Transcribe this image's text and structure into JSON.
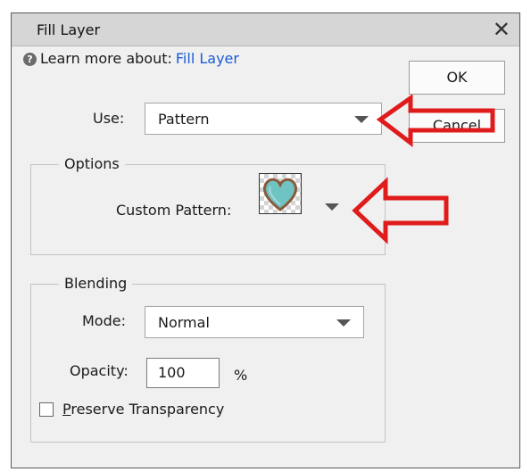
{
  "dialog": {
    "title": "Fill Layer",
    "close_glyph": "✕",
    "help_prefix": "Learn more about:",
    "help_link": "Fill Layer",
    "ok_label": "OK",
    "cancel_label": "Cancel"
  },
  "use": {
    "label": "Use:",
    "value": "Pattern"
  },
  "options": {
    "legend": "Options",
    "pattern_label": "Custom Pattern:",
    "pattern_icon": "heart-pattern-icon"
  },
  "blending": {
    "legend": "Blending",
    "mode_label": "Mode:",
    "mode_value": "Normal",
    "opacity_label": "Opacity:",
    "opacity_value": "100",
    "opacity_unit": "%",
    "preserve_label_underlined": "P",
    "preserve_label_rest": "reserve Transparency",
    "preserve_checked": false
  },
  "annotations": {
    "arrow_color": "#e01b1b"
  }
}
